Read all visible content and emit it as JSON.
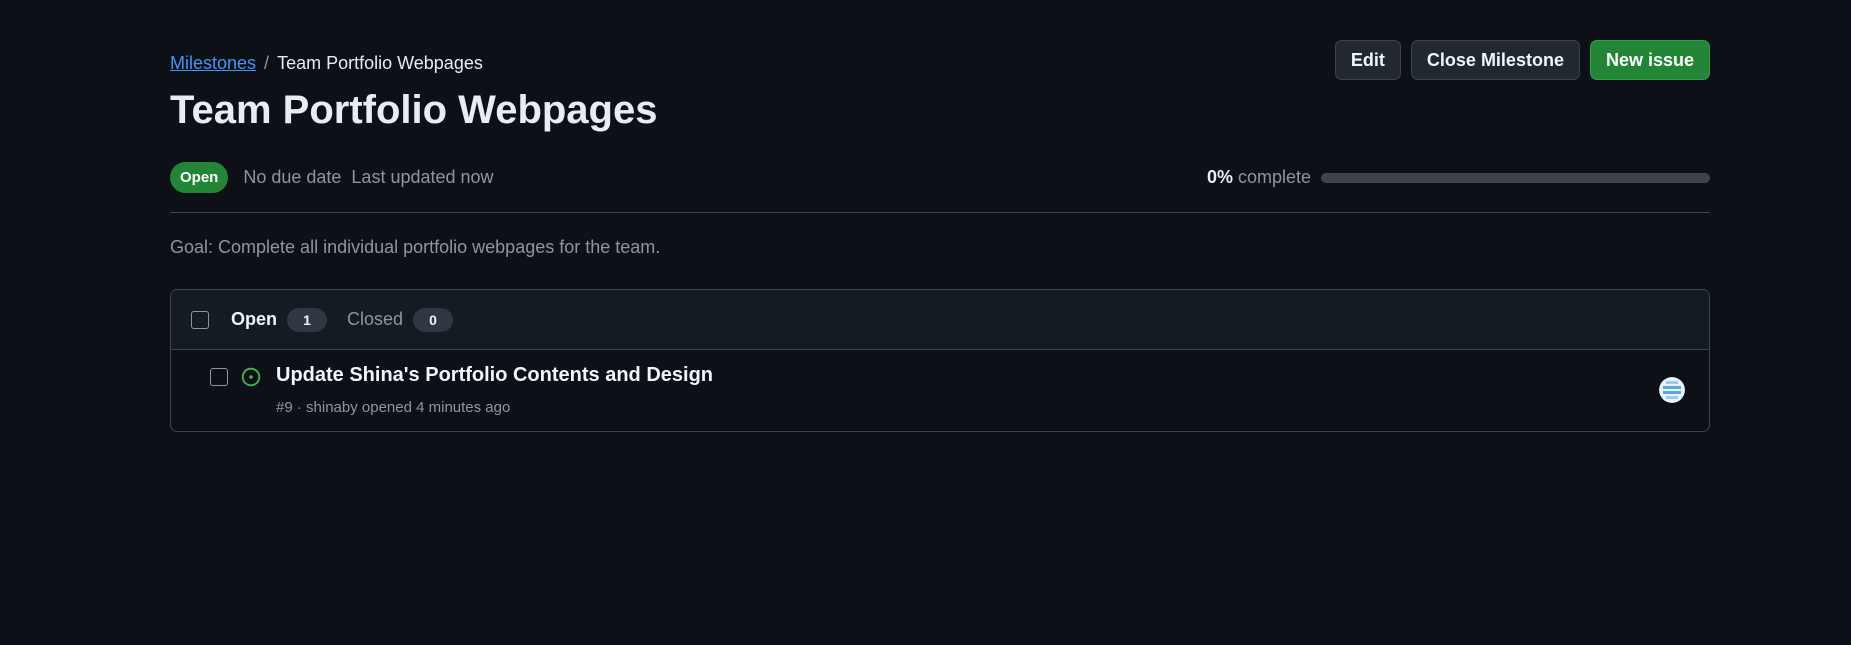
{
  "breadcrumb": {
    "parent": "Milestones",
    "separator": "/",
    "current": "Team Portfolio Webpages"
  },
  "title": "Team Portfolio Webpages",
  "actions": {
    "edit": "Edit",
    "close_milestone": "Close Milestone",
    "new_issue": "New issue"
  },
  "meta": {
    "state": "Open",
    "due": "No due date",
    "updated": "Last updated now"
  },
  "progress": {
    "percent_label": "0%",
    "suffix": "complete",
    "value": 0
  },
  "description": "Goal: Complete all individual portfolio webpages for the team.",
  "issues": {
    "tabs": {
      "open_label": "Open",
      "open_count": "1",
      "closed_label": "Closed",
      "closed_count": "0"
    },
    "rows": [
      {
        "title": "Update Shina's Portfolio Contents and Design",
        "meta": "#9 · shinaby opened 4 minutes ago"
      }
    ]
  },
  "colors": {
    "background": "#0d1117",
    "accent_green": "#238636",
    "link_blue": "#4493f8",
    "open_issue_icon": "#3fb950"
  }
}
